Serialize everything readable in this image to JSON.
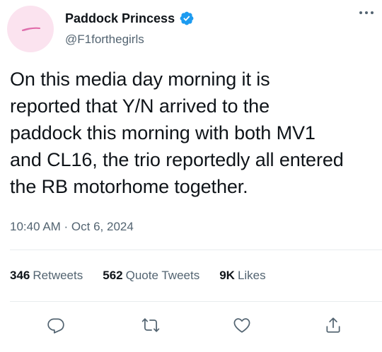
{
  "tweet": {
    "display_name": "Paddock Princess",
    "handle": "@F1forthegirls",
    "text": "On this media day morning it is\nreported that Y/N arrived to the\npaddock this morning with both MV1\nand CL16, the trio reportedly all entered\nthe RB motorhome together.",
    "timestamp": "10:40 AM · Oct 6, 2024"
  },
  "stats": {
    "retweets_count": "346",
    "retweets_label": "Retweets",
    "quote_count": "562",
    "quote_label": "Quote Tweets",
    "likes_count": "9K",
    "likes_label": "Likes"
  },
  "icons": {
    "verified": "verified-badge-icon",
    "more": "more-icon",
    "reply": "reply-icon",
    "retweet": "retweet-icon",
    "like": "heart-icon",
    "share": "share-icon"
  },
  "colors": {
    "verified_blue": "#1d9bf0",
    "secondary_text": "#536471",
    "avatar_bg": "#fbe3ef",
    "avatar_accent": "#e26aa8"
  }
}
